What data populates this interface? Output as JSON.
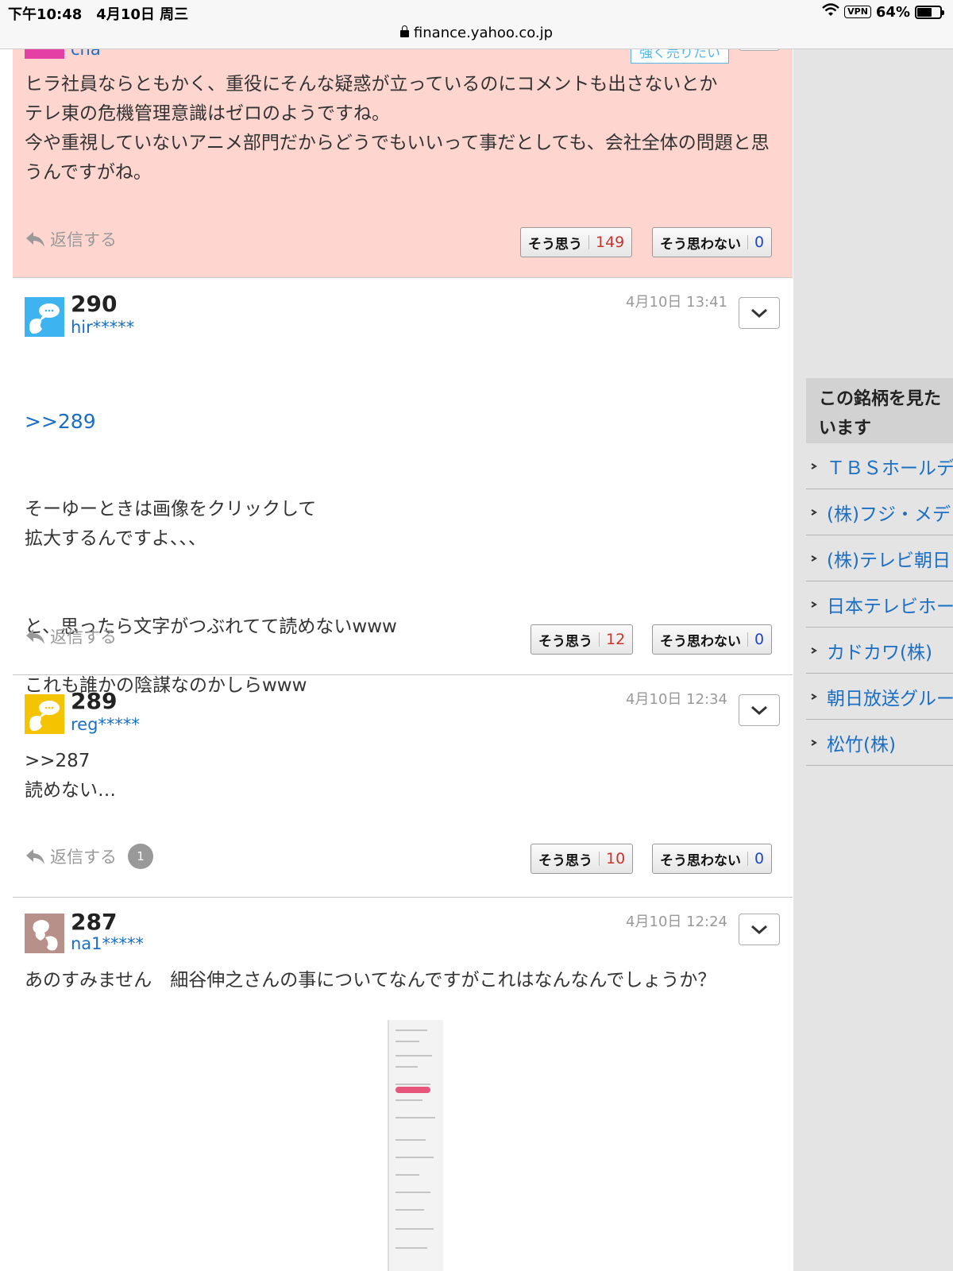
{
  "status_bar": {
    "time": "下午10:48　4月10日 周三",
    "vpn": "VPN",
    "battery": "64%",
    "battery_level": 0.64,
    "url": "finance.yahoo.co.jp"
  },
  "posts": [
    {
      "user_id": "cha",
      "sentiment_badge": "強く売りたい",
      "body": "ヒラ社員ならともかく、重役にそんな疑惑が立っているのにコメントも出さないとか\nテレ東の危機管理意識はゼロのようですね。\n今や重視していないアニメ部門だからどうでもいいって事だとしても、会社全体の問題と思うんですがね。",
      "reply_label": "返信する",
      "agree_label": "そう思う",
      "agree_count": "149",
      "disagree_label": "そう思わない",
      "disagree_count": "0"
    },
    {
      "number": "290",
      "user_id": "hir*****",
      "date": "4月10日 13:41",
      "anchor": ">>289",
      "body": "そーゆーときは画像をクリックして\n拡大するんですよ、、、\n\n\nと、思ったら文字がつぶれてて読めないwww\n\nこれも誰かの陰謀なのかしらwww",
      "reply_label": "返信する",
      "agree_label": "そう思う",
      "agree_count": "12",
      "disagree_label": "そう思わない",
      "disagree_count": "0"
    },
    {
      "number": "289",
      "user_id": "reg*****",
      "date": "4月10日 12:34",
      "body": ">>287\n読めない…",
      "reply_label": "返信する",
      "reply_count": "1",
      "agree_label": "そう思う",
      "agree_count": "10",
      "disagree_label": "そう思わない",
      "disagree_count": "0"
    },
    {
      "number": "287",
      "user_id": "na1*****",
      "date": "4月10日 12:24",
      "body": "あのすみません　細谷伸之さんの事についてなんですがこれはなんなんでしょうか？"
    }
  ],
  "sidebar": {
    "title": "この銘柄を見た\nいます",
    "items": [
      "ＴＢＳホールデ",
      "(株)フジ・メデ",
      "(株)テレビ朝日",
      "日本テレビホー",
      "カドカワ(株)",
      "朝日放送グルー",
      "松竹(株)"
    ]
  },
  "colors": {
    "link": "#1a6fc4",
    "agree": "#c8352d",
    "disagree": "#2049c0",
    "highlight_bg": "#ffd6cf",
    "sell_badge": "#57b7e6",
    "avatar_blue": "#3db3f0",
    "avatar_yellow": "#f5c400",
    "avatar_brown": "#b8908a",
    "avatar_pink": "#e43fa4"
  },
  "icons": [
    "lock-icon",
    "wifi-icon",
    "battery-icon",
    "reply-icon",
    "chevron-down-icon",
    "speech-bubble-icon",
    "user-silhouette-icon"
  ]
}
